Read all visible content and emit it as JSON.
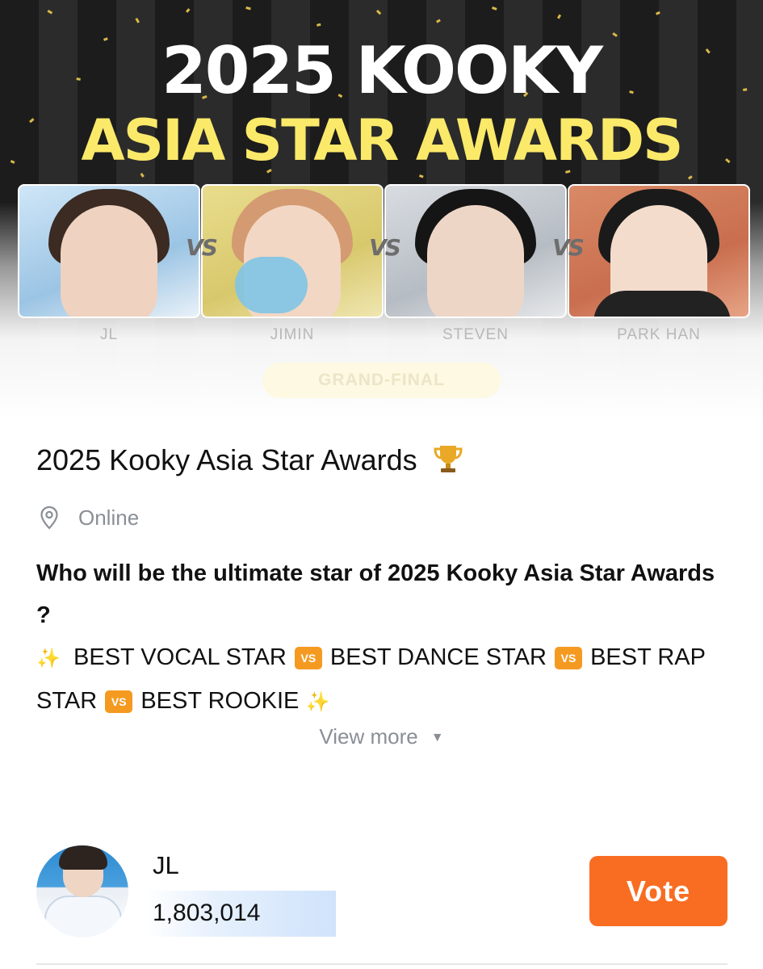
{
  "banner": {
    "title_line1": "2025 KOOKY",
    "title_line2": "ASIA STAR AWARDS",
    "vs_label": "VS",
    "candidates": [
      "JL",
      "JIMIN",
      "STEVEN",
      "PARK HAN"
    ],
    "stage": "GRAND-FINAL"
  },
  "event": {
    "title": "2025 Kooky Asia Star Awards",
    "trophy_icon": "trophy-icon",
    "location_icon": "location-pin-icon",
    "location": "Online",
    "question": "Who will be the ultimate star of 2025 Kooky Asia Star Awards ?",
    "categories": [
      "BEST VOCAL STAR",
      "BEST DANCE STAR",
      "BEST RAP STAR",
      "BEST ROOKIE"
    ],
    "vs_badge": "VS",
    "view_more": "View more"
  },
  "candidate": {
    "name": "JL",
    "votes": "1,803,014",
    "vote_button": "Vote"
  },
  "colors": {
    "accent": "#f86d22",
    "title_yellow": "#fbe96a",
    "muted": "#8a8f96"
  }
}
